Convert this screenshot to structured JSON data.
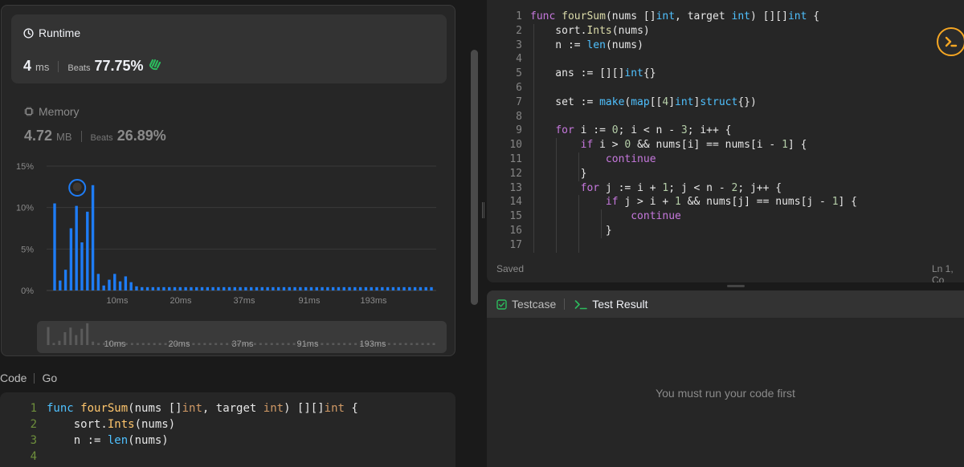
{
  "runtime": {
    "title": "Runtime",
    "value": "4",
    "unit": "ms",
    "beats_label": "Beats",
    "beats_value": "77.75%"
  },
  "memory": {
    "title": "Memory",
    "value": "4.72",
    "unit": "MB",
    "beats_label": "Beats",
    "beats_value": "26.89%"
  },
  "chart_data": {
    "type": "bar",
    "ylabels": [
      "15%",
      "10%",
      "5%",
      "0%"
    ],
    "ylim": [
      0,
      15
    ],
    "xtick_labels": [
      "10ms",
      "20ms",
      "37ms",
      "91ms",
      "193ms"
    ],
    "values": [
      10.5,
      1.2,
      2.5,
      7.5,
      10.2,
      5.8,
      9.5,
      12.7,
      2.0,
      0.6,
      1.3,
      2.0,
      1.1,
      1.7,
      1.0,
      0.5,
      0.4,
      0.4,
      0.4,
      0.4,
      0.4,
      0.4,
      0.4,
      0.4,
      0.4,
      0.4,
      0.4,
      0.4,
      0.4,
      0.4,
      0.4,
      0.4,
      0.4,
      0.4,
      0.4,
      0.4,
      0.4,
      0.4,
      0.4,
      0.4,
      0.4,
      0.4,
      0.4,
      0.4,
      0.4,
      0.4,
      0.4,
      0.4,
      0.4,
      0.4,
      0.4,
      0.4,
      0.4,
      0.4,
      0.4,
      0.4,
      0.4,
      0.4,
      0.4,
      0.4,
      0.4,
      0.4,
      0.4,
      0.4,
      0.4,
      0.4,
      0.4,
      0.4,
      0.4,
      0.4
    ],
    "user_bar_index": 4,
    "bar_color": "#1e7cf5",
    "grid": true
  },
  "code_section": {
    "label": "Code",
    "language": "Go",
    "lines": [
      {
        "num": "1",
        "text": "func fourSum(nums []int, target int) [][]int {"
      },
      {
        "num": "2",
        "text": "    sort.Ints(nums)"
      },
      {
        "num": "3",
        "text": "    n := len(nums)"
      },
      {
        "num": "4",
        "text": ""
      }
    ]
  },
  "editor": {
    "lines": [
      {
        "num": "1",
        "text": "func fourSum(nums []int, target int) [][]int {"
      },
      {
        "num": "2",
        "text": "    sort.Ints(nums)"
      },
      {
        "num": "3",
        "text": "    n := len(nums)"
      },
      {
        "num": "4",
        "text": ""
      },
      {
        "num": "5",
        "text": "    ans := [][]int{}"
      },
      {
        "num": "6",
        "text": ""
      },
      {
        "num": "7",
        "text": "    set := make(map[[4]int]struct{})"
      },
      {
        "num": "8",
        "text": ""
      },
      {
        "num": "9",
        "text": "    for i := 0; i < n - 3; i++ {"
      },
      {
        "num": "10",
        "text": "        if i > 0 && nums[i] == nums[i - 1] {"
      },
      {
        "num": "11",
        "text": "            continue"
      },
      {
        "num": "12",
        "text": "        }"
      },
      {
        "num": "13",
        "text": "        for j := i + 1; j < n - 2; j++ {"
      },
      {
        "num": "14",
        "text": "            if j > i + 1 && nums[j] == nums[j - 1] {"
      },
      {
        "num": "15",
        "text": "                continue"
      },
      {
        "num": "16",
        "text": "            }"
      },
      {
        "num": "17",
        "text": ""
      }
    ],
    "status": "Saved",
    "cursor": "Ln 1, Co"
  },
  "test_panel": {
    "tab_testcase": "Testcase",
    "tab_result": "Test Result",
    "empty_message": "You must run your code first"
  },
  "colors": {
    "accent_green": "#2cbb5d",
    "bar_blue": "#1e7cf5",
    "ai_orange": "#f5a623"
  }
}
